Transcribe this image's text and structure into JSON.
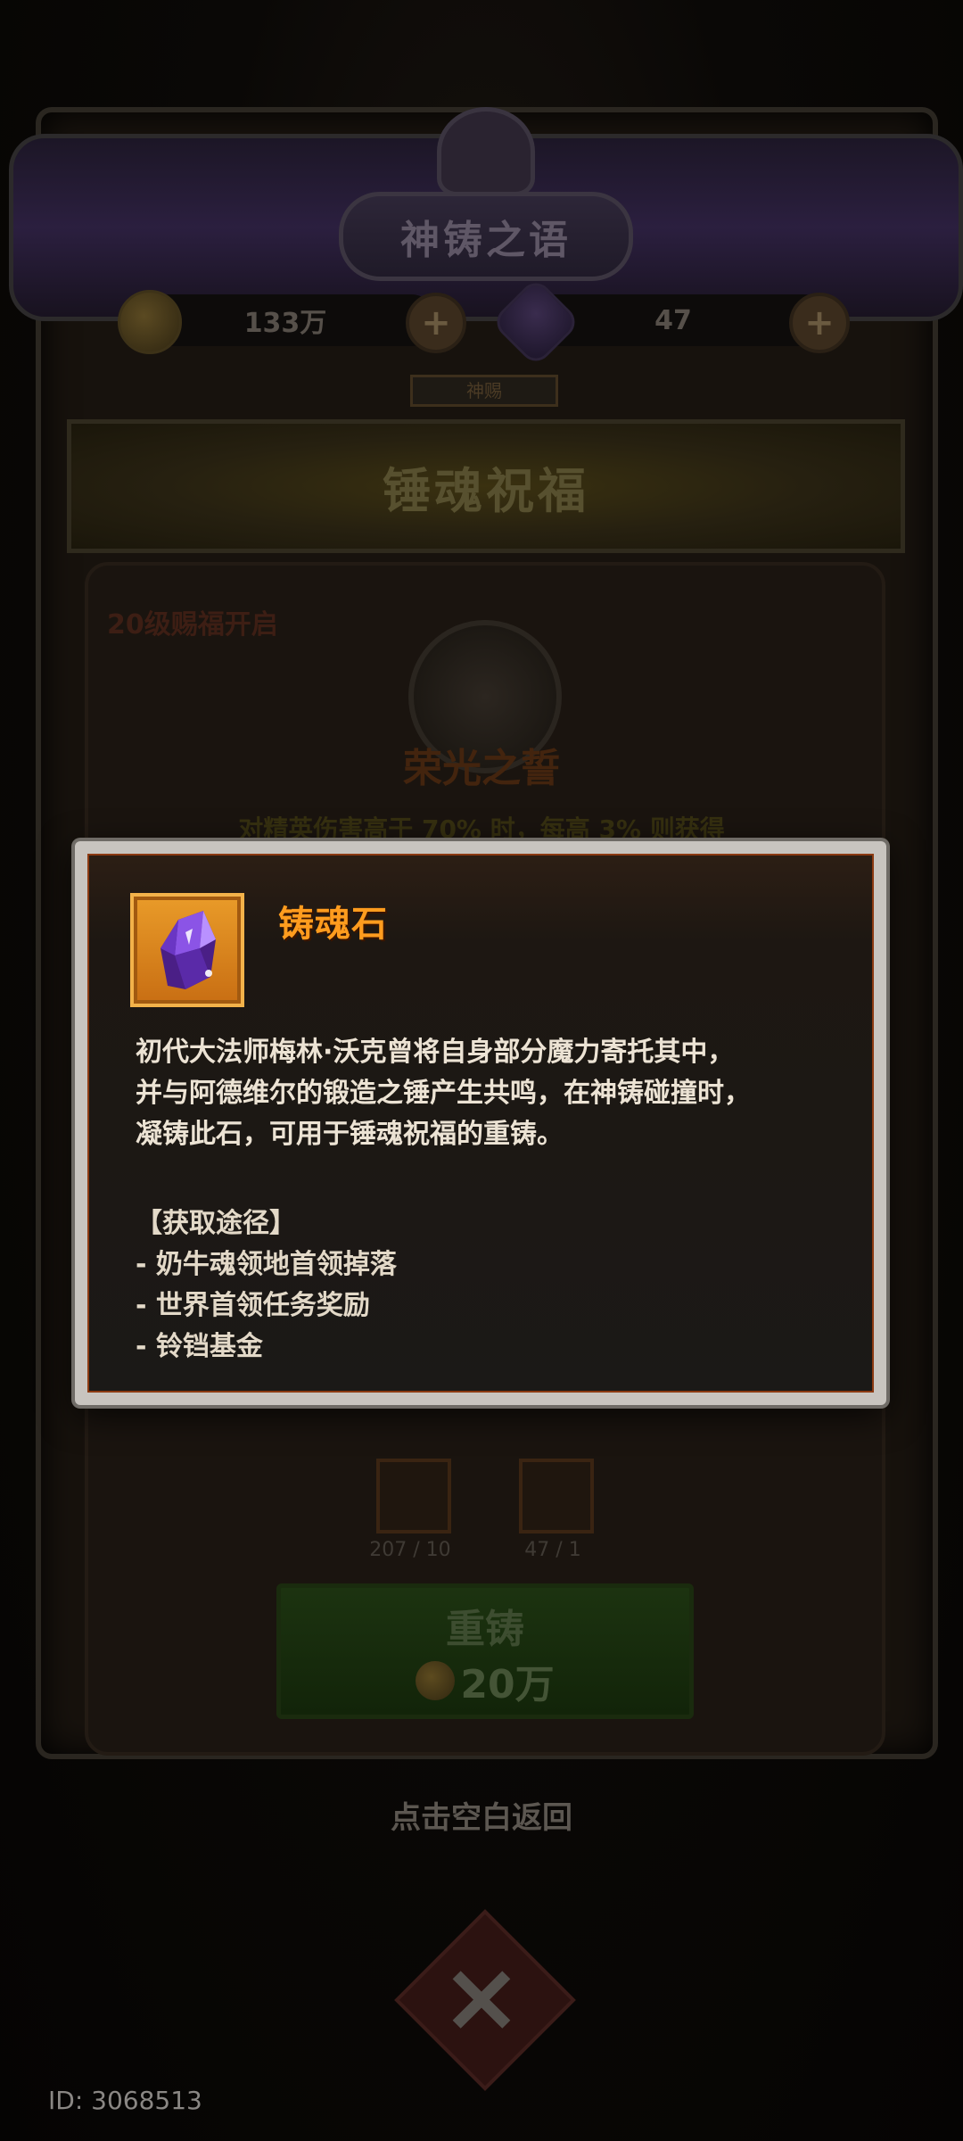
{
  "header": {
    "title": "神铸之语",
    "coins": "133万",
    "gems": "47",
    "plus_label": "+"
  },
  "tab_marker": "神赐",
  "section": {
    "banner": "锤魂祝福",
    "unlock_note": "20级赐福开启",
    "blessing_name": "荣光之誓",
    "blessing_desc": "对精英伤害高于 70% 时，每高 3% 则获得"
  },
  "materials": [
    {
      "icon": "horn-icon",
      "count": "207 / 10"
    },
    {
      "icon": "soul-stone-icon",
      "count": "47 / 1"
    }
  ],
  "reforge": {
    "label": "重铸",
    "cost": "20万"
  },
  "tap_return": "点击空白返回",
  "id_label": "ID: 3068513",
  "tooltip": {
    "item_name": "铸魂石",
    "item_icon": "purple-crystal-icon",
    "description": [
      "初代大法师梅林·沃克曾将自身部分魔力寄托其中，",
      "并与阿德维尔的锻造之锤产生共鸣，在神铸碰撞时，",
      "凝铸此石，可用于锤魂祝福的重铸。"
    ],
    "acquire_title": "【获取途径】",
    "acquire_sources": [
      "- 奶牛魂领地首领掉落",
      "- 世界首领任务奖励",
      "- 铃铛基金"
    ]
  },
  "colors": {
    "item_title": "#ff9c1e",
    "item_slot": "#e99b29",
    "tooltip_bg": "#1b1917"
  }
}
